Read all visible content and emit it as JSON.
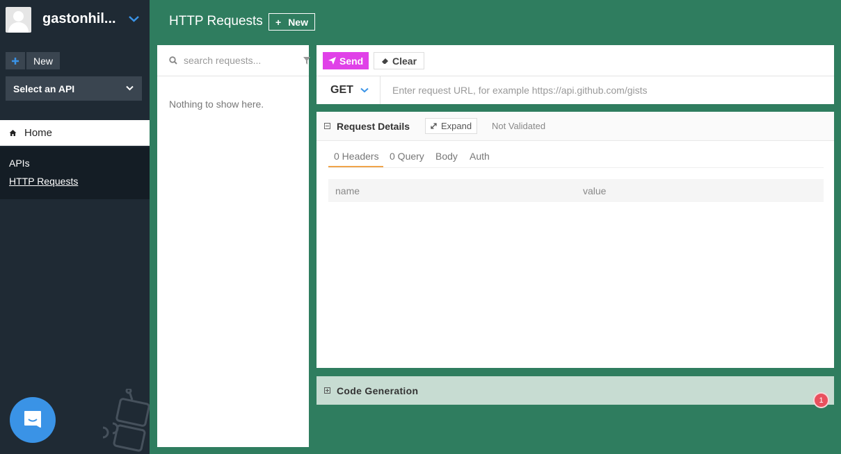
{
  "user": {
    "name": "gastonhil..."
  },
  "sidebar": {
    "new_label": "New",
    "select_api": "Select an API",
    "home_label": "Home",
    "nav": [
      {
        "label": "APIs"
      },
      {
        "label": "HTTP Requests"
      }
    ]
  },
  "header": {
    "title": "HTTP Requests",
    "new_label": "New"
  },
  "requests": {
    "search_placeholder": "search requests...",
    "empty_text": "Nothing to show here."
  },
  "request": {
    "send_label": "Send",
    "clear_label": "Clear",
    "method": "GET",
    "url_placeholder": "Enter request URL, for example https://api.github.com/gists"
  },
  "details": {
    "title": "Request Details",
    "expand_label": "Expand",
    "status": "Not Validated",
    "tabs": [
      {
        "label": "0 Headers"
      },
      {
        "label": "0 Query"
      },
      {
        "label": "Body"
      },
      {
        "label": "Auth"
      }
    ],
    "columns": [
      "name",
      "value"
    ]
  },
  "code_generation": {
    "title": "Code Generation"
  },
  "notification_badge": "1",
  "colors": {
    "background": "#2f7d5f",
    "sidebar": "#1f2a34",
    "send": "#e041e8",
    "tab_accent": "#f0a44a",
    "badge": "#e9505e"
  }
}
